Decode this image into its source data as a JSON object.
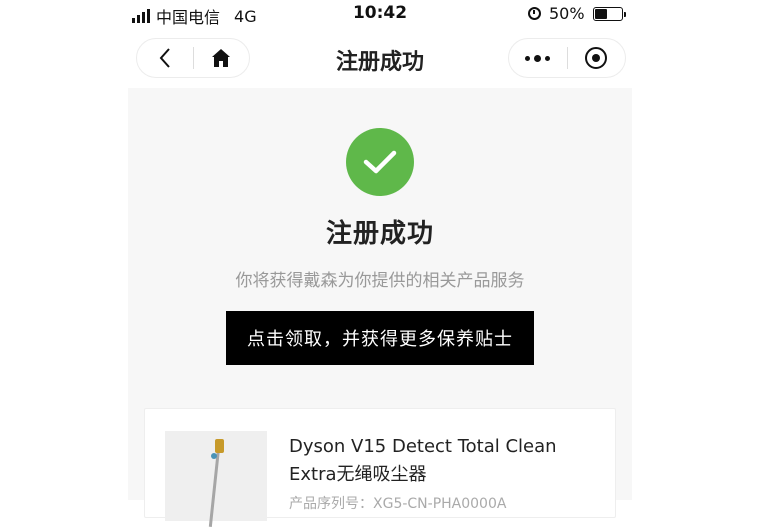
{
  "status_bar": {
    "carrier": "中国电信",
    "network": "4G",
    "time": "10:42",
    "battery_percent": "50%",
    "battery_level": 0.5
  },
  "nav": {
    "title": "注册成功",
    "back_icon": "chevron-left-icon",
    "home_icon": "home-icon",
    "more_icon": "more-dots-icon",
    "close_icon": "target-circle-icon"
  },
  "success": {
    "icon": "check-icon",
    "icon_color": "#5fb84a",
    "title": "注册成功",
    "subtitle": "你将获得戴森为你提供的相关产品服务",
    "cta_label": "点击领取，并获得更多保养贴士"
  },
  "product": {
    "name": "Dyson V15 Detect Total Clean Extra无绳吸尘器",
    "meta": "产品序列号：XG5-CN-PHA0000A"
  },
  "colors": {
    "accent_green": "#5fb84a",
    "button_bg": "#000000",
    "subtitle_gray": "#999999"
  }
}
